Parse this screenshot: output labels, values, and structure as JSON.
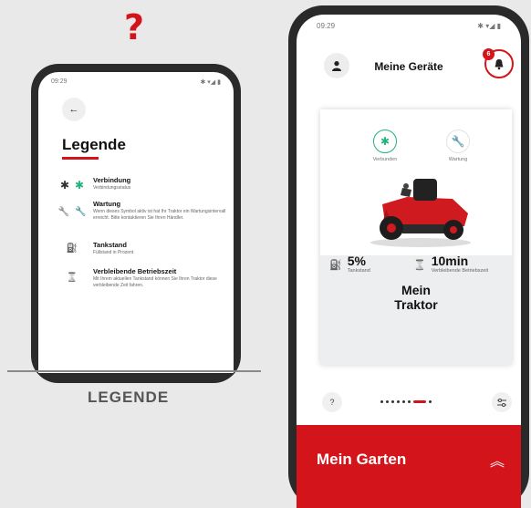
{
  "question_mark": "?",
  "legend_phone": {
    "status_time": "09:29",
    "status_icons": "✱ ▾◢ ▮",
    "back_arrow": "←",
    "title": "Legende",
    "items": [
      {
        "icon": "bluetooth-icon",
        "glyph_a": "✱",
        "glyph_b": "✱",
        "title": "Verbindung",
        "desc": "Verbindungsstatus"
      },
      {
        "icon": "wrench-icon",
        "glyph_a": "🔧",
        "glyph_b": "🔧",
        "title": "Wartung",
        "desc": "Wenn dieses Symbol aktiv ist hat Ihr Traktor ein Wartungsintervall erreicht. Bitte kontaktieren Sie Ihren Händler."
      },
      {
        "icon": "fuel-icon",
        "glyph_a": "⛽",
        "glyph_b": "",
        "title": "Tankstand",
        "desc": "Füllstand in Prozent"
      },
      {
        "icon": "hourglass-icon",
        "glyph_a": "⌛",
        "glyph_b": "",
        "title": "Verbleibende Betriebszeit",
        "desc": "Mit Ihrem aktuellen Tankstand können Sie Ihren Traktor diese verbleibende Zeit fahren."
      }
    ],
    "caption": "LEGENDE"
  },
  "devices_phone": {
    "status_time": "09:29",
    "status_icons": "✱ ▾◢ ▮",
    "header_title": "Meine Geräte",
    "notification_count": "6",
    "status_connected": "Verbunden",
    "status_maintenance": "Wartung",
    "tractor_name_line1": "Mein",
    "tractor_name_line2": "Traktor",
    "fuel_value": "5%",
    "fuel_label": "Tankstand",
    "time_value": "10min",
    "time_label": "Verbleibende Betriebszeit",
    "help_glyph": "?",
    "pager_dots": 8,
    "pager_active_index": 6,
    "garden_title": "Mein Garten",
    "garden_arrow": "︽"
  },
  "colors": {
    "brand_red": "#d3151b",
    "green": "#21b37c"
  }
}
